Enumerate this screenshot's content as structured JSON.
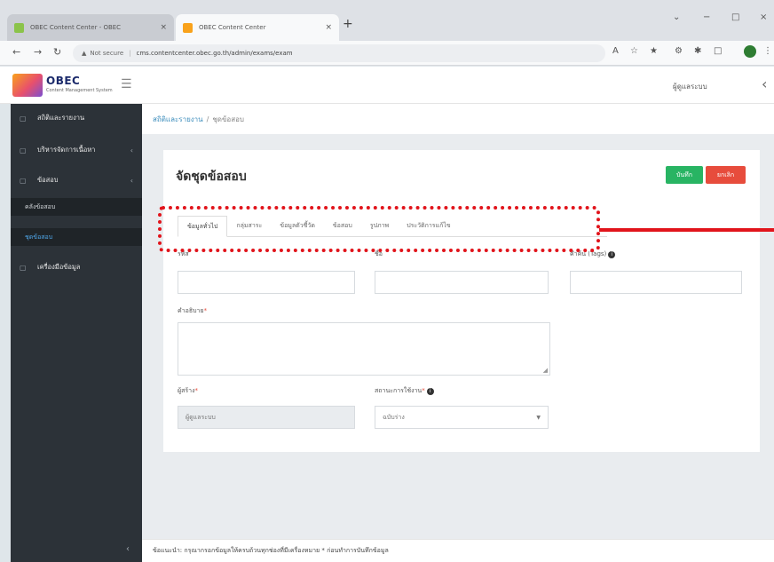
{
  "browser": {
    "tabs": [
      {
        "title": "OBEC Content Center - OBEC",
        "favicon_color": "#8bc34a"
      },
      {
        "title": "OBEC Content Center",
        "favicon_color": "#f9a21b"
      }
    ],
    "close_glyph": "×",
    "new_tab_glyph": "+",
    "window_controls": [
      "⌄",
      "−",
      "□",
      "×"
    ],
    "nav": {
      "back": "←",
      "forward": "→",
      "reload": "↻"
    },
    "address": {
      "security_icon": "warning-triangle-icon",
      "security_glyph": "▲",
      "security_label": "Not secure",
      "separator": "|",
      "url": "cms.contentcenter.obec.go.th/admin/exams/exam"
    },
    "toolbar_glyphs": [
      "A",
      "☆",
      "★",
      "⚙",
      "✱",
      "□",
      "⋮"
    ]
  },
  "app": {
    "logo_text": "OBEC",
    "logo_sub": "Content Management System",
    "hamburger_glyph": "☰",
    "user_name": "ผู้ดูแลระบบ",
    "collapse_glyph": "‹"
  },
  "sidebar": {
    "items": [
      {
        "label": "สถิติและรายงาน",
        "icon": "chart-icon",
        "glyph": "▢",
        "caret": ""
      },
      {
        "label": "บริหารจัดการเนื้อหา",
        "icon": "folder-icon",
        "glyph": "▢",
        "caret": "‹"
      },
      {
        "label": "ข้อสอบ",
        "icon": "exam-icon",
        "glyph": "▢",
        "caret": "‹"
      }
    ],
    "subitems": [
      {
        "label": "คลังข้อสอบ",
        "active": false
      },
      {
        "label": "ชุดข้อสอบ",
        "active": true
      }
    ],
    "bottom_item": {
      "label": "เครื่องมือข้อมูล",
      "icon": "tools-icon",
      "glyph": "▢"
    },
    "collapse_glyph": "‹"
  },
  "breadcrumb": {
    "root": "สถิติและรายงาน",
    "separator": "/",
    "current": "ชุดข้อสอบ"
  },
  "form": {
    "title": "จัดชุดข้อสอบ",
    "save_label": "บันทึก",
    "cancel_label": "ยกเลิก",
    "tabs": [
      {
        "label": "ข้อมูลทั่วไป",
        "active": true
      },
      {
        "label": "กลุ่มสาระ",
        "active": false
      },
      {
        "label": "ข้อมูลตัวชี้วัด",
        "active": false
      },
      {
        "label": "ข้อสอบ",
        "active": false
      },
      {
        "label": "รูปภาพ",
        "active": false
      },
      {
        "label": "ประวัติการแก้ไข",
        "active": false
      }
    ],
    "fields": {
      "code": {
        "label": "รหัส",
        "value": ""
      },
      "name": {
        "label": "ชื่อ",
        "value": ""
      },
      "tags": {
        "label": "คำค้น (Tags)",
        "value": ""
      },
      "description": {
        "label": "คำอธิบาย",
        "required": "*"
      },
      "owner": {
        "label": "ผู้สร้าง",
        "required": "*",
        "value": "ผู้ดูแลระบบ"
      },
      "status": {
        "label": "สถานะการใช้งาน",
        "required": "*",
        "value": "ฉบับร่าง"
      }
    },
    "info_glyph": "i",
    "dropdown_glyph": "▼",
    "resize_glyph": "◢"
  },
  "footer": {
    "text": "ข้อแนะนำ: กรุณากรอกข้อมูลให้ครบถ้วนทุกช่องที่มีเครื่องหมาย * ก่อนทำการบันทึกข้อมูล"
  },
  "colors": {
    "highlight": "#e1141b",
    "save": "#28b463",
    "cancel": "#e74c3c",
    "sidebar": "#2c3238",
    "active_link": "#4fa6e8"
  }
}
